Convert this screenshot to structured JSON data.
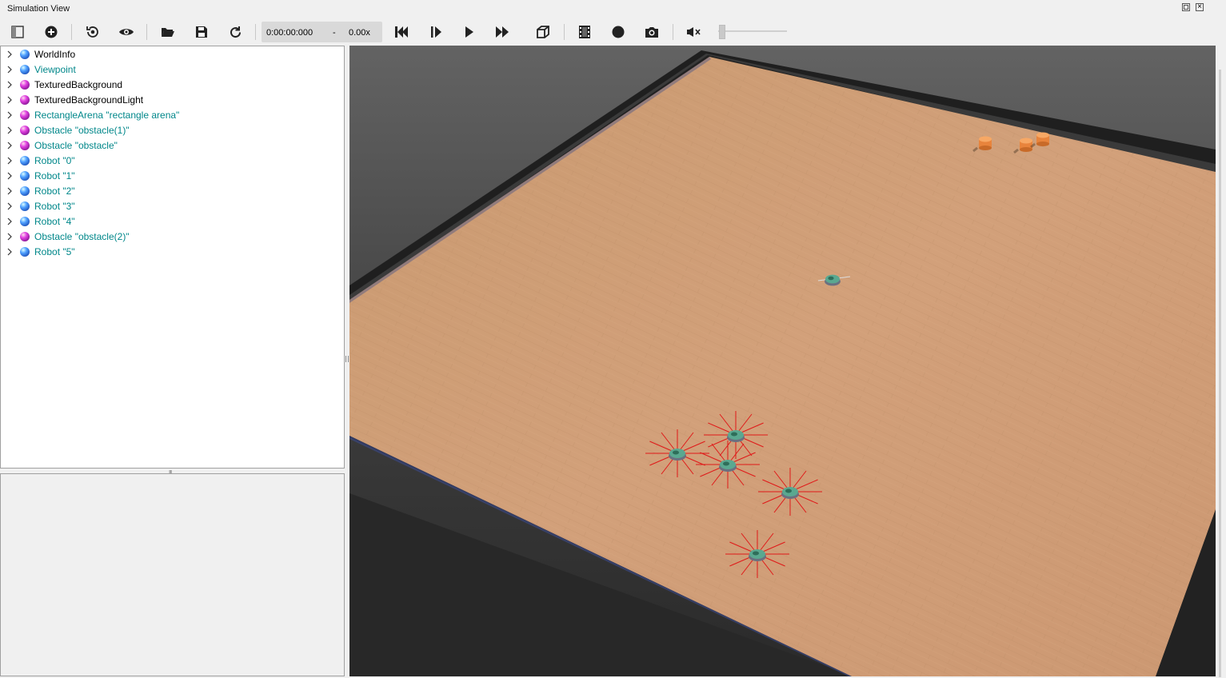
{
  "window": {
    "title": "Simulation View"
  },
  "toolbar": {
    "buttons": [
      {
        "name": "toggle-scene-tree-button",
        "icon": "scene-tree-toggle-icon"
      },
      {
        "name": "add-node-button",
        "icon": "plus-circle-icon"
      },
      {
        "name": "reset-viewpoint-button",
        "icon": "viewpoint-reset-icon"
      },
      {
        "name": "view-menu-button",
        "icon": "eye-icon"
      },
      {
        "name": "open-world-button",
        "icon": "folder-open-icon"
      },
      {
        "name": "save-world-button",
        "icon": "save-icon"
      },
      {
        "name": "reload-world-button",
        "icon": "reload-icon"
      },
      {
        "name": "reset-simulation-button",
        "icon": "skip-back-icon"
      },
      {
        "name": "step-button",
        "icon": "step-icon"
      },
      {
        "name": "run-button",
        "icon": "play-icon"
      },
      {
        "name": "fast-button",
        "icon": "fast-forward-icon"
      },
      {
        "name": "rendering-toggle-button",
        "icon": "cube-icon"
      },
      {
        "name": "record-movie-button",
        "icon": "film-icon"
      },
      {
        "name": "record-animation-button",
        "icon": "record-dot-icon"
      },
      {
        "name": "screenshot-button",
        "icon": "camera-icon"
      },
      {
        "name": "mute-button",
        "icon": "speaker-muted-icon"
      }
    ],
    "time": "0:00:00:000",
    "time_separator": "-",
    "speed": "0.00x",
    "volume_level": 0
  },
  "scene_tree": {
    "items": [
      {
        "label": "WorldInfo",
        "color": "#000000",
        "ball": "blue"
      },
      {
        "label": "Viewpoint",
        "color": "#00878a",
        "ball": "blue"
      },
      {
        "label": "TexturedBackground",
        "color": "#000000",
        "ball": "magenta"
      },
      {
        "label": "TexturedBackgroundLight",
        "color": "#000000",
        "ball": "magenta"
      },
      {
        "label": "RectangleArena \"rectangle arena\"",
        "color": "#00878a",
        "ball": "magenta"
      },
      {
        "label": "Obstacle \"obstacle(1)\"",
        "color": "#00878a",
        "ball": "magenta"
      },
      {
        "label": "Obstacle \"obstacle\"",
        "color": "#00878a",
        "ball": "magenta"
      },
      {
        "label": "Robot \"0\"",
        "color": "#00878a",
        "ball": "blue"
      },
      {
        "label": "Robot \"1\"",
        "color": "#00878a",
        "ball": "blue"
      },
      {
        "label": "Robot \"2\"",
        "color": "#00878a",
        "ball": "blue"
      },
      {
        "label": "Robot \"3\"",
        "color": "#00878a",
        "ball": "blue"
      },
      {
        "label": "Robot \"4\"",
        "color": "#00878a",
        "ball": "blue"
      },
      {
        "label": "Obstacle \"obstacle(2)\"",
        "color": "#00878a",
        "ball": "magenta"
      },
      {
        "label": "Robot \"5\"",
        "color": "#00878a",
        "ball": "blue"
      }
    ]
  },
  "colors": {
    "floor": "#cf9d72",
    "wall": "#2b2b2b",
    "sensor_ray": "#e01818",
    "obstacle": "#e8843c",
    "robot": "#5aa890"
  }
}
